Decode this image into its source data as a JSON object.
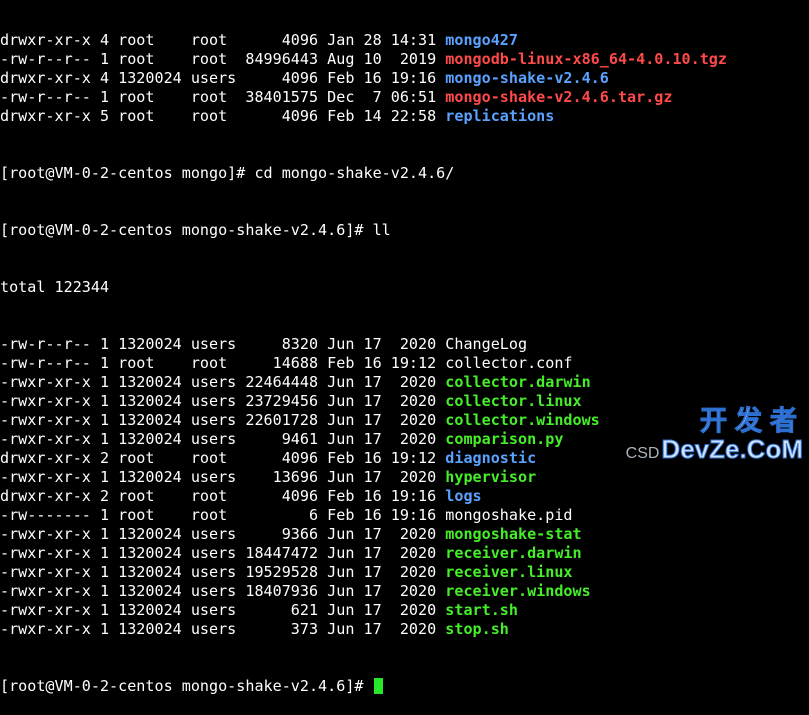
{
  "colors": {
    "background": "#000000",
    "text": "#ffffff",
    "directory": "#5aa2ff",
    "executable": "#46ee2a",
    "archive": "#ff4a4a",
    "cursor": "#27e829"
  },
  "listing_top": [
    {
      "meta": "drwxr-xr-x 4 root    root      4096 Jan 28 14:31 ",
      "name": "mongo427",
      "kind": "dir"
    },
    {
      "meta": "-rw-r--r-- 1 root    root  84996443 Aug 10  2019 ",
      "name": "mongodb-linux-x86_64-4.0.10.tgz",
      "kind": "archive"
    },
    {
      "meta": "drwxr-xr-x 4 1320024 users     4096 Feb 16 19:16 ",
      "name": "mongo-shake-v2.4.6",
      "kind": "dir"
    },
    {
      "meta": "-rw-r--r-- 1 root    root  38401575 Dec  7 06:51 ",
      "name": "mongo-shake-v2.4.6.tar.gz",
      "kind": "archive"
    },
    {
      "meta": "drwxr-xr-x 5 root    root      4096 Feb 14 22:58 ",
      "name": "replications",
      "kind": "dir"
    }
  ],
  "commands": {
    "cd": "[root@VM-0-2-centos mongo]# cd mongo-shake-v2.4.6/",
    "ll": "[root@VM-0-2-centos mongo-shake-v2.4.6]# ll"
  },
  "total_line": "total 122344",
  "listing_main": [
    {
      "meta": "-rw-r--r-- 1 1320024 users     8320 Jun 17  2020 ",
      "name": "ChangeLog",
      "kind": "plain"
    },
    {
      "meta": "-rw-r--r-- 1 root    root     14688 Feb 16 19:12 ",
      "name": "collector.conf",
      "kind": "plain"
    },
    {
      "meta": "-rwxr-xr-x 1 1320024 users 22464448 Jun 17  2020 ",
      "name": "collector.darwin",
      "kind": "exec"
    },
    {
      "meta": "-rwxr-xr-x 1 1320024 users 23729456 Jun 17  2020 ",
      "name": "collector.linux",
      "kind": "exec"
    },
    {
      "meta": "-rwxr-xr-x 1 1320024 users 22601728 Jun 17  2020 ",
      "name": "collector.windows",
      "kind": "exec"
    },
    {
      "meta": "-rwxr-xr-x 1 1320024 users     9461 Jun 17  2020 ",
      "name": "comparison.py",
      "kind": "exec"
    },
    {
      "meta": "drwxr-xr-x 2 root    root      4096 Feb 16 19:12 ",
      "name": "diagnostic",
      "kind": "dir"
    },
    {
      "meta": "-rwxr-xr-x 1 1320024 users    13696 Jun 17  2020 ",
      "name": "hypervisor",
      "kind": "exec"
    },
    {
      "meta": "drwxr-xr-x 2 root    root      4096 Feb 16 19:16 ",
      "name": "logs",
      "kind": "dir"
    },
    {
      "meta": "-rw------- 1 root    root         6 Feb 16 19:16 ",
      "name": "mongoshake.pid",
      "kind": "plain"
    },
    {
      "meta": "-rwxr-xr-x 1 1320024 users     9366 Jun 17  2020 ",
      "name": "mongoshake-stat",
      "kind": "exec"
    },
    {
      "meta": "-rwxr-xr-x 1 1320024 users 18447472 Jun 17  2020 ",
      "name": "receiver.darwin",
      "kind": "exec"
    },
    {
      "meta": "-rwxr-xr-x 1 1320024 users 19529528 Jun 17  2020 ",
      "name": "receiver.linux",
      "kind": "exec"
    },
    {
      "meta": "-rwxr-xr-x 1 1320024 users 18407936 Jun 17  2020 ",
      "name": "receiver.windows",
      "kind": "exec"
    },
    {
      "meta": "-rwxr-xr-x 1 1320024 users      621 Jun 17  2020 ",
      "name": "start.sh",
      "kind": "exec"
    },
    {
      "meta": "-rwxr-xr-x 1 1320024 users      373 Jun 17  2020 ",
      "name": "stop.sh",
      "kind": "exec"
    }
  ],
  "prompt_final": "[root@VM-0-2-centos mongo-shake-v2.4.6]# ",
  "watermark": {
    "cn": "开发者",
    "csdn": "CSD",
    "en": "DevZe.CoM"
  }
}
